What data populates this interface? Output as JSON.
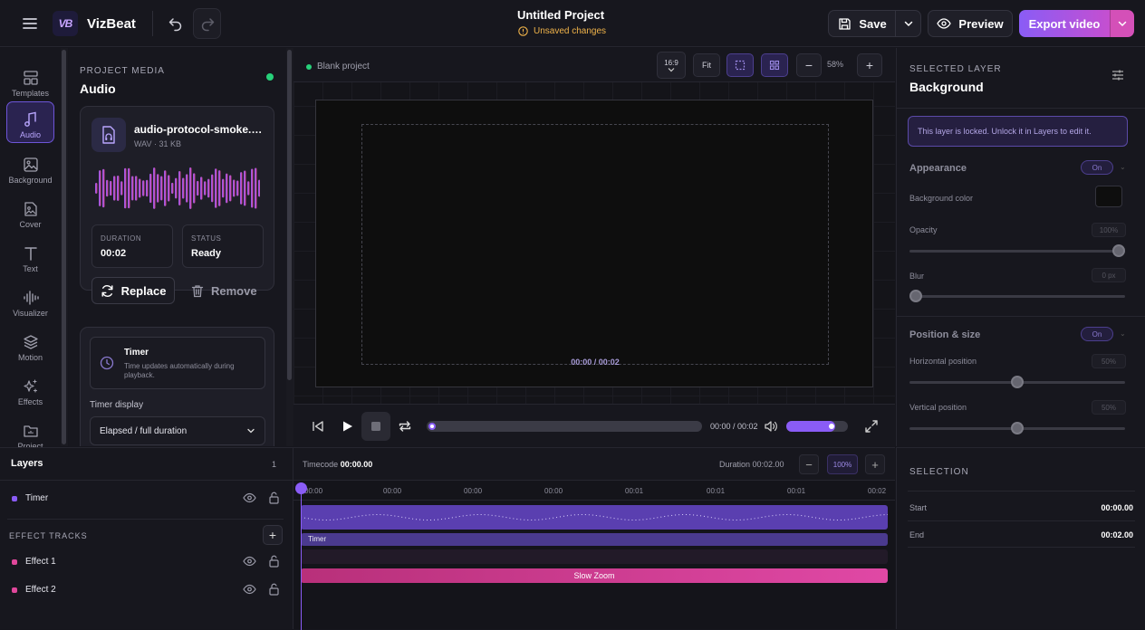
{
  "header": {
    "brand": "VizBeat",
    "logo_text": "VB",
    "project_title": "Untitled Project",
    "unsaved": "Unsaved changes",
    "save": "Save",
    "preview": "Preview",
    "export": "Export video"
  },
  "rail": {
    "items": [
      {
        "label": "Templates"
      },
      {
        "label": "Audio"
      },
      {
        "label": "Background"
      },
      {
        "label": "Cover"
      },
      {
        "label": "Text"
      },
      {
        "label": "Visualizer"
      },
      {
        "label": "Motion"
      },
      {
        "label": "Effects"
      },
      {
        "label": "Project"
      }
    ],
    "active": "Audio"
  },
  "media": {
    "section_label": "PROJECT MEDIA",
    "title": "Audio",
    "file_name": "audio-protocol-smoke.wav",
    "file_meta": "WAV · 31 KB",
    "duration_label": "DURATION",
    "duration_value": "00:02",
    "status_label": "STATUS",
    "status_value": "Ready",
    "replace": "Replace",
    "remove": "Remove",
    "timer_title": "Timer",
    "timer_desc": "Time updates automatically during playback.",
    "timer_display_label": "Timer display",
    "timer_display_value": "Elapsed / full duration"
  },
  "canvas": {
    "status": "Blank project",
    "aspect": "16:9",
    "fit": "Fit",
    "zoom": "58%",
    "time": "00:00 / 00:02"
  },
  "playback": {
    "time": "00:00 / 00:02",
    "progress": 0.0,
    "volume": 0.8
  },
  "inspector": {
    "section_label": "SELECTED LAYER",
    "title": "Background",
    "locked_msg": "This layer is locked. Unlock it in Layers to edit it.",
    "appearance": "Appearance",
    "appearance_toggle": "On",
    "bg_color_label": "Background color",
    "bg_color": "#0e0e0e",
    "opacity_label": "Opacity",
    "opacity_value": "100%",
    "opacity": 1.0,
    "blur_label": "Blur",
    "blur_value": "0 px",
    "blur": 0.0,
    "pos_section": "Position & size",
    "pos_toggle": "On",
    "hpos_label": "Horizontal position",
    "hpos_value": "50%",
    "hpos": 0.5,
    "vpos_label": "Vertical position",
    "vpos_value": "50%",
    "vpos": 0.5
  },
  "layers": {
    "title": "Layers",
    "count": "1",
    "items": [
      {
        "name": "Timer",
        "color": "#8a5cf6"
      }
    ],
    "effect_tracks_label": "EFFECT TRACKS",
    "effects": [
      {
        "name": "Effect 1",
        "color": "#e0479b"
      },
      {
        "name": "Effect 2",
        "color": "#e0479b"
      }
    ]
  },
  "timeline": {
    "timecode_label": "Timecode",
    "timecode": "00:00.00",
    "duration": "Duration 00:02.00",
    "zoom": "100%",
    "ticks": [
      "00:00",
      "00:00",
      "00:00",
      "00:00",
      "00:01",
      "00:01",
      "00:01",
      "00:02"
    ],
    "timer_track": "Timer",
    "zoom_track": "Slow Zoom"
  },
  "selection": {
    "title": "SELECTION",
    "start_label": "Start",
    "start": "00:00.00",
    "end_label": "End",
    "end": "00:02.00"
  }
}
